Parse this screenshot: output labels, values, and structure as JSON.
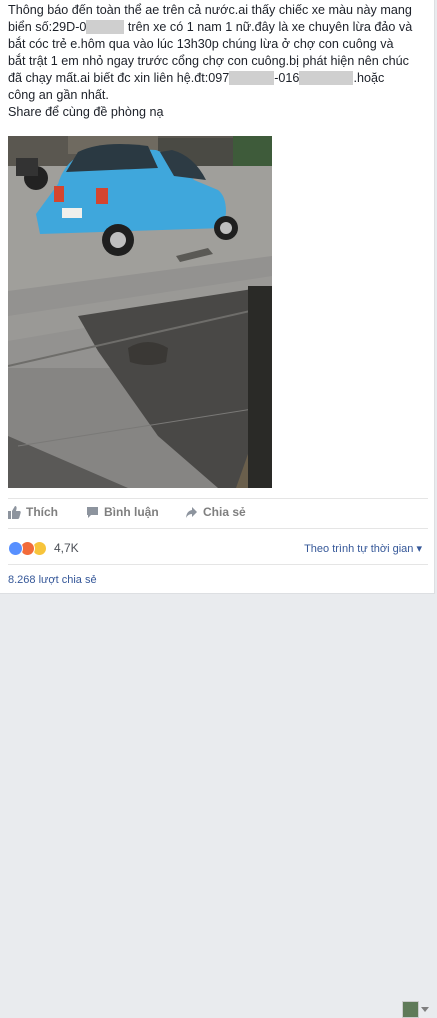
{
  "post": {
    "line1": "Thông báo đến toàn thể ae trên cả nước.ai thấy chiếc xe màu này mang",
    "line2_a": "biển số:29D-0",
    "line2_b": " trên xe có 1 nam 1 nữ.đây là xe chuyên lừa đảo và",
    "line3": "bắt cóc trẻ e.hôm qua vào lúc 13h30p chúng lừa ở chợ con cuông và",
    "line4": "bắt trật 1 em nhỏ ngay trước cổng chợ con cuông.bị phát hiện nên chúc",
    "line5_a": "đã chạy mất.ai biết đc xin liên hệ.đt:097",
    "line5_b": "-016",
    "line5_c": ".hoặc",
    "line6": "công an gần nhất.",
    "line7": "Share để cùng đề phòng nạ"
  },
  "actions": {
    "like_label": "Thích",
    "comment_label": "Bình luận",
    "share_label": "Chia sẻ"
  },
  "reactions": {
    "count": "4,7K",
    "sort_label": "Theo trình tự thời gian",
    "colors": {
      "like": "#5890ff",
      "angry": "#f26b3a",
      "sad": "#f7c43b"
    }
  },
  "shares_label": "8.268 lượt chia sẻ"
}
